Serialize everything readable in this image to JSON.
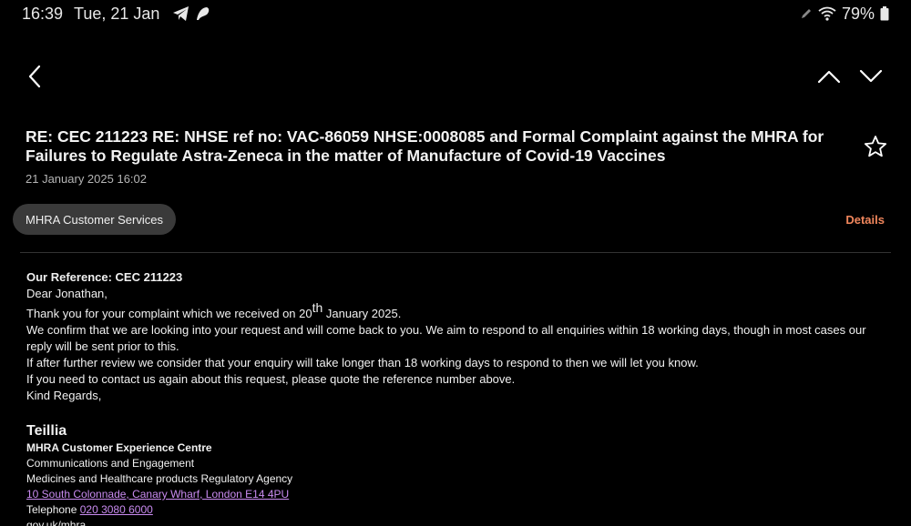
{
  "status_bar": {
    "time": "16:39",
    "date": "Tue, 21 Jan",
    "battery": "79%",
    "icons": [
      "telegram-icon",
      "app-icon",
      "pen-icon",
      "wifi-icon",
      "battery-icon"
    ]
  },
  "email": {
    "subject": "RE: CEC 211223 RE: NHSE ref no: VAC-86059 NHSE:0008085 and Formal Complaint against the MHRA for Failures to Regulate Astra-Zeneca in the matter of Manufacture of Covid-19 Vaccines",
    "date": "21 January 2025  16:02",
    "sender": "MHRA Customer Services",
    "details_label": "Details",
    "body": {
      "reference": "Our Reference: CEC 211223",
      "greeting": "Dear Jonathan,",
      "line1_pre": "Thank you for your complaint which we received on 20",
      "line1_sup": "th",
      "line1_post": " January 2025.",
      "line2": "We confirm that we are looking into your request and will come back to you. We aim to respond to all enquiries within 18 working days, though in most cases our reply will be sent prior to this.",
      "line3": "If after further review we consider that your enquiry will take longer than 18 working days to respond to then we will let you know.",
      "line4": "If you need to contact us again about this request, please quote the reference number above.",
      "signoff": "Kind Regards,"
    },
    "signature": {
      "name": "Teillia",
      "org": "MHRA Customer Experience Centre",
      "dept": "Communications and Engagement",
      "agency": "Medicines and Healthcare products Regulatory Agency",
      "address": "10 South Colonnade, Canary Wharf, London E14 4PU",
      "telephone_label": "Telephone ",
      "telephone": "020 3080 6000",
      "web": "gov.uk/mhra"
    }
  },
  "colors": {
    "background": "#000000",
    "accent": "#f0865c",
    "link": "#c98bf0",
    "chip": "#3a3a3a"
  }
}
